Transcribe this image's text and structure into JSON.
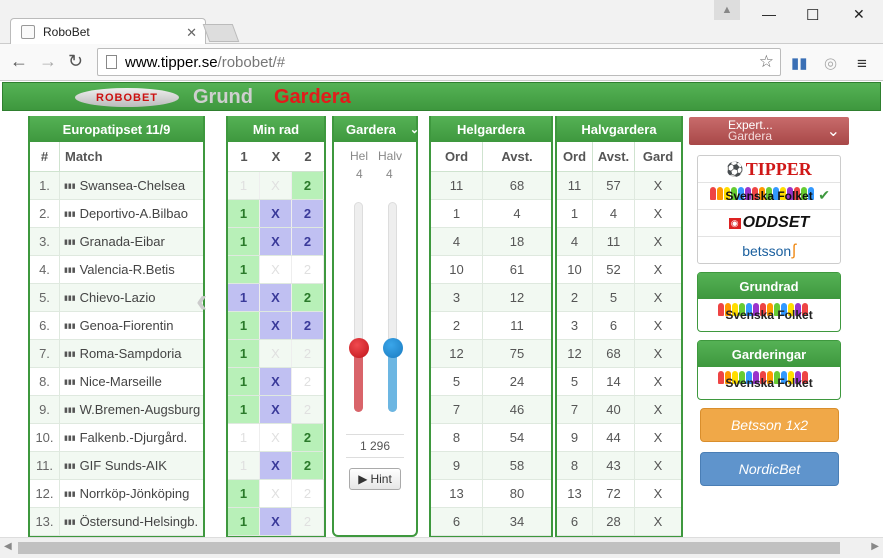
{
  "browser": {
    "tab_title": "RoboBet",
    "url_host": "www.tipper.se",
    "url_path": "/robobet/#"
  },
  "app": {
    "logo_text": "ROBOBET",
    "nav_grund": "Grund",
    "nav_gardera": "Gardera"
  },
  "match_panel": {
    "title": "Europatipset 11/9",
    "col_num": "#",
    "col_match": "Match"
  },
  "rad_panel": {
    "title": "Min rad",
    "cols": [
      "1",
      "X",
      "2"
    ]
  },
  "gardera_panel": {
    "title": "Gardera",
    "hel_label": "Hel",
    "halv_label": "Halv",
    "hel_value": "4",
    "halv_value": "4",
    "total": "1 296",
    "hint_label": "Hint"
  },
  "hel_panel": {
    "title": "Helgardera",
    "col_ord": "Ord",
    "col_avst": "Avst."
  },
  "halv_panel": {
    "title": "Halvgardera",
    "col_ord": "Ord",
    "col_avst": "Avst.",
    "col_gard": "Gard"
  },
  "matches": [
    {
      "num": "1.",
      "name": "Swansea-Chelsea",
      "p1": "1",
      "px": "X",
      "p2": "2",
      "s1": "off",
      "sx": "off",
      "s2": "on",
      "hel_ord": "11",
      "hel_avst": "68",
      "halv_ord": "11",
      "halv_avst": "57",
      "gard": "X"
    },
    {
      "num": "2.",
      "name": "Deportivo-A.Bilbao",
      "p1": "1",
      "px": "X",
      "p2": "2",
      "s1": "on",
      "sx": "x",
      "s2": "x",
      "hel_ord": "1",
      "hel_avst": "4",
      "halv_ord": "1",
      "halv_avst": "4",
      "gard": "X"
    },
    {
      "num": "3.",
      "name": "Granada-Eibar",
      "p1": "1",
      "px": "X",
      "p2": "2",
      "s1": "on",
      "sx": "x",
      "s2": "x",
      "hel_ord": "4",
      "hel_avst": "18",
      "halv_ord": "4",
      "halv_avst": "11",
      "gard": "X"
    },
    {
      "num": "4.",
      "name": "Valencia-R.Betis",
      "p1": "1",
      "px": "X",
      "p2": "2",
      "s1": "on",
      "sx": "off",
      "s2": "off",
      "hel_ord": "10",
      "hel_avst": "61",
      "halv_ord": "10",
      "halv_avst": "52",
      "gard": "X"
    },
    {
      "num": "5.",
      "name": "Chievo-Lazio",
      "p1": "1",
      "px": "X",
      "p2": "2",
      "s1": "x",
      "sx": "x",
      "s2": "on",
      "hel_ord": "3",
      "hel_avst": "12",
      "halv_ord": "2",
      "halv_avst": "5",
      "gard": "X"
    },
    {
      "num": "6.",
      "name": "Genoa-Fiorentin",
      "p1": "1",
      "px": "X",
      "p2": "2",
      "s1": "on",
      "sx": "x",
      "s2": "x",
      "hel_ord": "2",
      "hel_avst": "11",
      "halv_ord": "3",
      "halv_avst": "6",
      "gard": "X"
    },
    {
      "num": "7.",
      "name": "Roma-Sampdoria",
      "p1": "1",
      "px": "X",
      "p2": "2",
      "s1": "on",
      "sx": "off",
      "s2": "off",
      "hel_ord": "12",
      "hel_avst": "75",
      "halv_ord": "12",
      "halv_avst": "68",
      "gard": "X"
    },
    {
      "num": "8.",
      "name": "Nice-Marseille",
      "p1": "1",
      "px": "X",
      "p2": "2",
      "s1": "on",
      "sx": "x",
      "s2": "off",
      "hel_ord": "5",
      "hel_avst": "24",
      "halv_ord": "5",
      "halv_avst": "14",
      "gard": "X"
    },
    {
      "num": "9.",
      "name": "W.Bremen-Augsburg",
      "p1": "1",
      "px": "X",
      "p2": "2",
      "s1": "on",
      "sx": "x",
      "s2": "off",
      "hel_ord": "7",
      "hel_avst": "46",
      "halv_ord": "7",
      "halv_avst": "40",
      "gard": "X"
    },
    {
      "num": "10.",
      "name": "Falkenb.-Djurgård.",
      "p1": "1",
      "px": "X",
      "p2": "2",
      "s1": "off",
      "sx": "off",
      "s2": "on",
      "hel_ord": "8",
      "hel_avst": "54",
      "halv_ord": "9",
      "halv_avst": "44",
      "gard": "X"
    },
    {
      "num": "11.",
      "name": "GIF Sunds-AIK",
      "p1": "1",
      "px": "X",
      "p2": "2",
      "s1": "off",
      "sx": "x",
      "s2": "on",
      "hel_ord": "9",
      "hel_avst": "58",
      "halv_ord": "8",
      "halv_avst": "43",
      "gard": "X"
    },
    {
      "num": "12.",
      "name": "Norrköp-Jönköping",
      "p1": "1",
      "px": "X",
      "p2": "2",
      "s1": "on",
      "sx": "off",
      "s2": "off",
      "hel_ord": "13",
      "hel_avst": "80",
      "halv_ord": "13",
      "halv_avst": "72",
      "gard": "X"
    },
    {
      "num": "13.",
      "name": "Östersund-Helsingb.",
      "p1": "1",
      "px": "X",
      "p2": "2",
      "s1": "on",
      "sx": "x",
      "s2": "off",
      "hel_ord": "6",
      "hel_avst": "34",
      "halv_ord": "6",
      "halv_avst": "28",
      "gard": "X"
    }
  ],
  "sidebar": {
    "expert_title": "Expert...",
    "expert_sub": "Gardera",
    "brand_tipper": "TIPPER",
    "brand_svenska": "Svenska Folket",
    "brand_oddset": "ODDSET",
    "brand_betsson": "betsson",
    "grundrad_title": "Grundrad",
    "grundrad_source": "Svenska Folket",
    "garderingar_title": "Garderingar",
    "garderingar_source": "Svenska Folket",
    "betsson_btn": "Betsson 1x2",
    "nordic_btn": "NordicBet"
  },
  "colors": {
    "green": "#3e983e",
    "red": "#e21b1b",
    "pick_on": "#b8f0b8",
    "pick_x": "#c0c0f2",
    "slider_red": "#d9242a",
    "slider_blue": "#1e8fd6",
    "betsson": "#f0a848",
    "nordic": "#5f94cc"
  }
}
